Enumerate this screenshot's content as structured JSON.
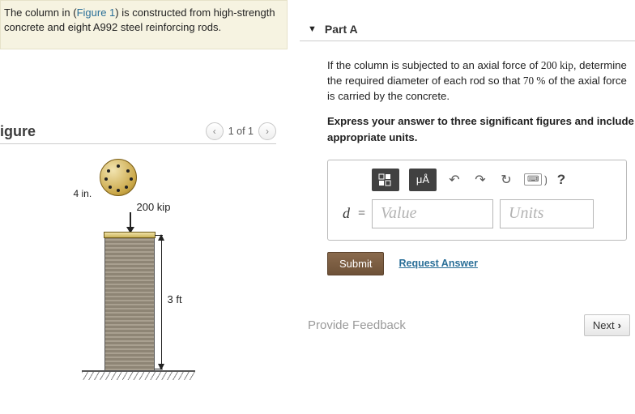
{
  "problem": {
    "pre": "The column in (",
    "figlink": "Figure 1",
    "post": ") is constructed from high-strength concrete and eight A992 steel reinforcing rods."
  },
  "figure": {
    "title": "igure",
    "counter": "1 of 1",
    "dim_radius": "4 in.",
    "force": "200 kip",
    "dim_height": "3 ft"
  },
  "part": {
    "label": "Part A",
    "question_1": "If the column is subjected to an axial force of ",
    "force_val": "200 ",
    "force_unit": "kip",
    "question_2": ", determine the required diameter of each rod so that ",
    "pct_val": "70 ",
    "pct_unit": "%",
    "question_3": " of the axial force is carried by the concrete.",
    "instruction": "Express your answer to three significant figures and include appropriate units."
  },
  "toolbar": {
    "units_label": "μÅ",
    "kbd_label": "⌨",
    "kbd_paren": "⟯",
    "help": "?"
  },
  "answer": {
    "variable": "d",
    "equals": "=",
    "value_placeholder": "Value",
    "units_placeholder": "Units"
  },
  "actions": {
    "submit": "Submit",
    "request": "Request Answer",
    "feedback": "Provide Feedback",
    "next": "Next"
  }
}
